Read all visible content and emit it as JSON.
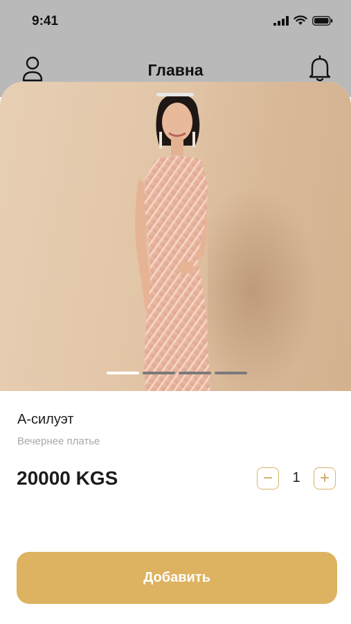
{
  "status_bar": {
    "time": "9:41"
  },
  "nav": {
    "title": "Главна"
  },
  "product": {
    "title": "А-силуэт",
    "subtitle": "Вечернее платье",
    "price": "20000 KGS",
    "quantity": "1",
    "carousel": {
      "total": 4,
      "active": 1
    }
  },
  "actions": {
    "minus": "−",
    "plus": "+",
    "add_label": "Добавить"
  },
  "colors": {
    "accent": "#ddb260",
    "accent_border": "#d9b36a",
    "header_bg": "#b9b9b9"
  }
}
